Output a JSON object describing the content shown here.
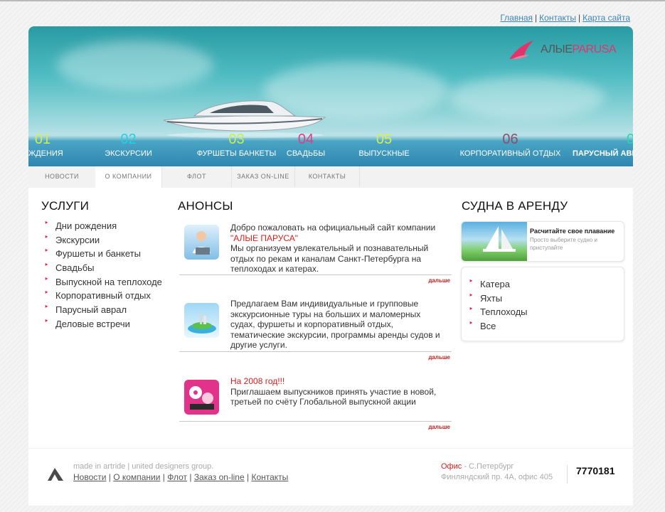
{
  "top_links": [
    "Главная",
    "Контакты",
    "Карта сайта"
  ],
  "logo": {
    "part1": "АЛЫЕ",
    "part2": "PARUSA"
  },
  "banner_items": [
    {
      "num": "01",
      "label": "ЖДЕНИЯ",
      "color": "#d6ea5b"
    },
    {
      "num": "02",
      "label": "ЭКСКУРСИИ",
      "color": "#1fd2e6"
    },
    {
      "num": "03",
      "label": "ФУРШЕТЫ БАНКЕТЫ",
      "color": "#c7ef4f"
    },
    {
      "num": "04",
      "label": "СВАДЬБЫ",
      "color": "#e53a88"
    },
    {
      "num": "05",
      "label": "ВЫПУСКНЫЕ",
      "color": "#d8ee55"
    },
    {
      "num": "06",
      "label": "КОРПОРАТИВНЫЙ ОТДЫХ",
      "color": "#8a4f6b"
    },
    {
      "num": "0",
      "label": "ПАРУСНЫЙ АВРАЛ",
      "color": "#27d7b0"
    }
  ],
  "tabs": [
    "НОВОСТИ",
    "О КОМПАНИИ",
    "ФЛОТ",
    "ЗАКАЗ ON-LINE",
    "КОНТАКТЫ"
  ],
  "services": {
    "title": "УСЛУГИ",
    "items": [
      "Дни рождения",
      "Экскурсии",
      "Фуршеты и банкеты",
      "Свадьбы",
      "Выпускной на теплоходе",
      "Корпоративный отдых",
      "Парусный аврал",
      "Деловые встречи"
    ]
  },
  "announcements": {
    "title": "АНОНСЫ",
    "more": "дальше",
    "n1": {
      "line1": "Добро пожаловать на официальный сайт компании",
      "red": "\"АЛЫЕ ПАРУСА\"",
      "rest": "Мы организуем увлекательный и познавательный отдых по рекам и каналам Санкт-Петербурга на теплоходах и катерах."
    },
    "n2": {
      "text": "Предлагаем Вам индивидуальные и групповые экскурсионные туры на больших и маломерных судах, фуршеты и корпоративный отдых, тематические экскурсии, программы аренды судов и другие услуги."
    },
    "n3": {
      "red": "На 2008 год!!!",
      "rest": "Приглашаем выпускников принять участие в новой, третьей по счёту Глобальной выпускной акции"
    }
  },
  "rent": {
    "title": "СУДНА В АРЕНДУ",
    "calc_title": "Расчитайте свое плавание",
    "calc_sub": "Просто выберите судно и приступайте",
    "items": [
      "Катера",
      "Яхты",
      "Теплоходы",
      "Все"
    ]
  },
  "footer": {
    "made": "made in artride | united designers group.",
    "links": [
      "Новости",
      "О компании",
      "Флот",
      "Заказ on-line",
      "Контакты"
    ],
    "office_label": "Офис",
    "office_city": " - С.Петербург",
    "address": "Финляндский пр. 4А, офис 405",
    "phone": "7770181"
  }
}
